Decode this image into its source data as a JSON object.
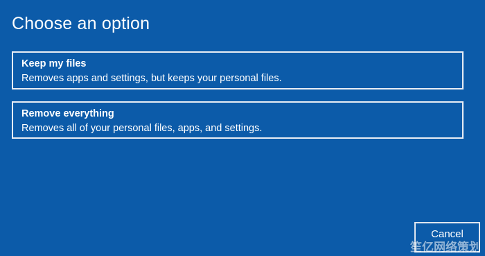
{
  "title": "Choose an option",
  "options": [
    {
      "label": "Keep my files",
      "description": "Removes apps and settings, but keeps your personal files."
    },
    {
      "label": "Remove everything",
      "description": "Removes all of your personal files, apps, and settings."
    }
  ],
  "cancel_label": "Cancel",
  "watermark_text": "笙亿网络策划",
  "colors": {
    "background": "#0c5ba9",
    "border": "#e9eef5",
    "text": "#ffffff"
  }
}
